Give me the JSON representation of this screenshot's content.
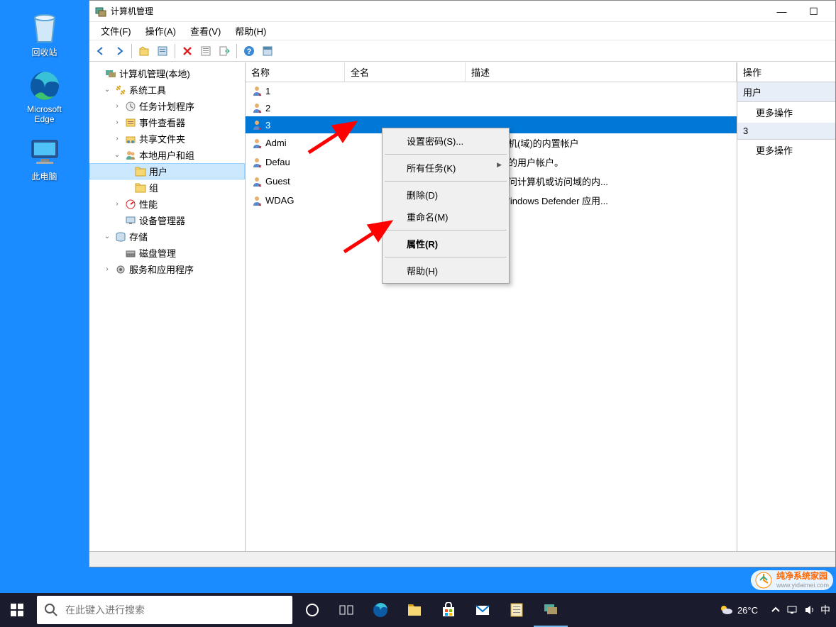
{
  "desktop": {
    "icons": [
      {
        "name": "recycle-bin",
        "label": "回收站"
      },
      {
        "name": "edge",
        "label": "Microsoft Edge"
      },
      {
        "name": "this-pc",
        "label": "此电脑"
      }
    ]
  },
  "window": {
    "title": "计算机管理",
    "menu": [
      "文件(F)",
      "操作(A)",
      "查看(V)",
      "帮助(H)"
    ]
  },
  "tree": {
    "root": "计算机管理(本地)",
    "system_tools": "系统工具",
    "task_scheduler": "任务计划程序",
    "event_viewer": "事件查看器",
    "shared_folders": "共享文件夹",
    "local_users": "本地用户和组",
    "users": "用户",
    "groups": "组",
    "performance": "性能",
    "device_manager": "设备管理器",
    "storage": "存储",
    "disk_management": "磁盘管理",
    "services_apps": "服务和应用程序"
  },
  "list": {
    "columns": {
      "name": "名称",
      "fullname": "全名",
      "description": "描述"
    },
    "rows": [
      {
        "name": "1",
        "fullname": "",
        "description": ""
      },
      {
        "name": "2",
        "fullname": "",
        "description": ""
      },
      {
        "name": "3",
        "fullname": "",
        "description": "",
        "selected": true
      },
      {
        "name": "Admi",
        "fullname": "",
        "description": "管理计算机(域)的内置帐户"
      },
      {
        "name": "Defau",
        "fullname": "",
        "description": "系统管理的用户帐户。"
      },
      {
        "name": "Guest",
        "fullname": "",
        "description": "供来宾访问计算机或访问域的内..."
      },
      {
        "name": "WDAG",
        "fullname": "",
        "description": "系统为 Windows Defender 应用..."
      }
    ]
  },
  "context_menu": {
    "set_password": "设置密码(S)...",
    "all_tasks": "所有任务(K)",
    "delete": "删除(D)",
    "rename": "重命名(M)",
    "properties": "属性(R)",
    "help": "帮助(H)"
  },
  "actions": {
    "header": "操作",
    "section1": "用户",
    "more1": "更多操作",
    "section2": "3",
    "more2": "更多操作"
  },
  "taskbar": {
    "search_placeholder": "在此键入进行搜索",
    "weather_temp": "26°C",
    "ime": "中"
  },
  "watermark": {
    "title": "纯净系统家园",
    "url": "www.yidaimei.com"
  }
}
